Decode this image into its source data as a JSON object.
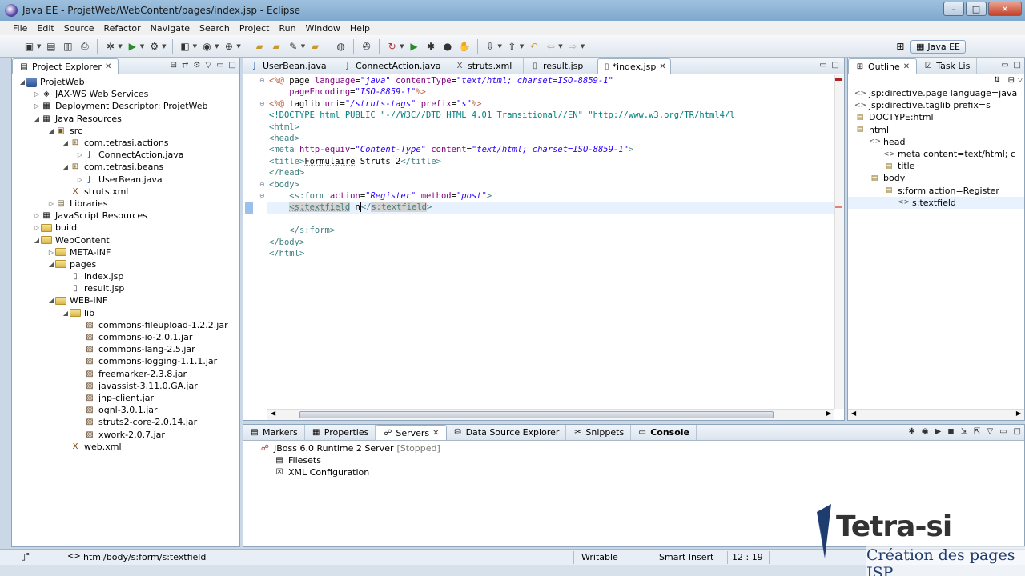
{
  "window": {
    "title": "Java EE - ProjetWeb/WebContent/pages/index.jsp - Eclipse"
  },
  "menu": [
    "File",
    "Edit",
    "Source",
    "Refactor",
    "Navigate",
    "Search",
    "Project",
    "Run",
    "Window",
    "Help"
  ],
  "perspective": {
    "label": "Java EE"
  },
  "explorer": {
    "tab_label": "Project Explorer",
    "items": [
      {
        "label": "ProjetWeb",
        "icon": "project-icon",
        "depth": 0,
        "twisty": "open"
      },
      {
        "label": "JAX-WS Web Services",
        "icon": "webservice-icon",
        "depth": 1,
        "twisty": "closed"
      },
      {
        "label": "Deployment Descriptor: ProjetWeb",
        "icon": "descriptor-icon",
        "depth": 1,
        "twisty": "closed"
      },
      {
        "label": "Java Resources",
        "icon": "java-resources-icon",
        "depth": 1,
        "twisty": "open"
      },
      {
        "label": "src",
        "icon": "source-folder-icon",
        "depth": 2,
        "twisty": "open"
      },
      {
        "label": "com.tetrasi.actions",
        "icon": "package-icon",
        "depth": 3,
        "twisty": "open"
      },
      {
        "label": "ConnectAction.java",
        "icon": "java-file-icon",
        "depth": 4,
        "twisty": "closed"
      },
      {
        "label": "com.tetrasi.beans",
        "icon": "package-icon",
        "depth": 3,
        "twisty": "open"
      },
      {
        "label": "UserBean.java",
        "icon": "java-file-icon",
        "depth": 4,
        "twisty": "closed"
      },
      {
        "label": "struts.xml",
        "icon": "xml-file-icon",
        "depth": 3,
        "twisty": "none"
      },
      {
        "label": "Libraries",
        "icon": "library-icon",
        "depth": 2,
        "twisty": "closed"
      },
      {
        "label": "JavaScript Resources",
        "icon": "javascript-icon",
        "depth": 1,
        "twisty": "closed"
      },
      {
        "label": "build",
        "icon": "folder-icon",
        "depth": 1,
        "twisty": "closed"
      },
      {
        "label": "WebContent",
        "icon": "folder-icon",
        "depth": 1,
        "twisty": "open"
      },
      {
        "label": "META-INF",
        "icon": "folder-icon",
        "depth": 2,
        "twisty": "closed"
      },
      {
        "label": "pages",
        "icon": "folder-open-icon",
        "depth": 2,
        "twisty": "open"
      },
      {
        "label": "index.jsp",
        "icon": "jsp-file-icon",
        "depth": 3,
        "twisty": "none"
      },
      {
        "label": "result.jsp",
        "icon": "jsp-file-icon",
        "depth": 3,
        "twisty": "none"
      },
      {
        "label": "WEB-INF",
        "icon": "folder-icon",
        "depth": 2,
        "twisty": "open"
      },
      {
        "label": "lib",
        "icon": "folder-open-icon",
        "depth": 3,
        "twisty": "open"
      },
      {
        "label": "commons-fileupload-1.2.2.jar",
        "icon": "jar-icon",
        "depth": 4,
        "twisty": "none"
      },
      {
        "label": "commons-io-2.0.1.jar",
        "icon": "jar-icon",
        "depth": 4,
        "twisty": "none"
      },
      {
        "label": "commons-lang-2.5.jar",
        "icon": "jar-icon",
        "depth": 4,
        "twisty": "none"
      },
      {
        "label": "commons-logging-1.1.1.jar",
        "icon": "jar-icon",
        "depth": 4,
        "twisty": "none"
      },
      {
        "label": "freemarker-2.3.8.jar",
        "icon": "jar-icon",
        "depth": 4,
        "twisty": "none"
      },
      {
        "label": "javassist-3.11.0.GA.jar",
        "icon": "jar-icon",
        "depth": 4,
        "twisty": "none"
      },
      {
        "label": "jnp-client.jar",
        "icon": "jar-icon",
        "depth": 4,
        "twisty": "none"
      },
      {
        "label": "ognl-3.0.1.jar",
        "icon": "jar-icon",
        "depth": 4,
        "twisty": "none"
      },
      {
        "label": "struts2-core-2.0.14.jar",
        "icon": "jar-icon",
        "depth": 4,
        "twisty": "none"
      },
      {
        "label": "xwork-2.0.7.jar",
        "icon": "jar-icon",
        "depth": 4,
        "twisty": "none"
      },
      {
        "label": "web.xml",
        "icon": "xml-file-icon",
        "depth": 3,
        "twisty": "none"
      }
    ]
  },
  "editor": {
    "tabs": [
      {
        "label": "UserBean.java",
        "active": false
      },
      {
        "label": "ConnectAction.java",
        "active": false
      },
      {
        "label": "struts.xml",
        "active": false
      },
      {
        "label": "result.jsp",
        "active": false
      },
      {
        "label": "*index.jsp",
        "active": true
      }
    ],
    "lines": [
      "<%@ page language=\"java\" contentType=\"text/html; charset=ISO-8859-1\"",
      "    pageEncoding=\"ISO-8859-1\"%>",
      "<%@ taglib uri=\"/struts-tags\" prefix=\"s\"%>",
      "<!DOCTYPE html PUBLIC \"-//W3C//DTD HTML 4.01 Transitional//EN\" \"http://www.w3.org/TR/html4/l",
      "<html>",
      "<head>",
      "<meta http-equiv=\"Content-Type\" content=\"text/html; charset=ISO-8859-1\">",
      "<title>Formulaire Struts 2</title>",
      "</head>",
      "<body>",
      "    <s:form action=\"Register\" method=\"post\">",
      "    <s:textfield n</s:textfield>",
      "",
      "    </s:form>",
      "</body>",
      "</html>"
    ]
  },
  "outline": {
    "tabs": [
      {
        "label": "Outline",
        "active": true
      },
      {
        "label": "Task Lis",
        "active": false
      }
    ],
    "items": [
      {
        "label": "jsp:directive.page language=java",
        "depth": 1,
        "icon": "tag-icon"
      },
      {
        "label": "jsp:directive.taglib prefix=s",
        "depth": 1,
        "icon": "tag-icon"
      },
      {
        "label": "DOCTYPE:html",
        "depth": 1,
        "icon": "doctype-icon"
      },
      {
        "label": "html",
        "depth": 1,
        "icon": "element-icon"
      },
      {
        "label": "head",
        "depth": 2,
        "icon": "tag-icon"
      },
      {
        "label": "meta content=text/html; c",
        "depth": 3,
        "icon": "tag-icon"
      },
      {
        "label": "title",
        "depth": 3,
        "icon": "element-icon"
      },
      {
        "label": "body",
        "depth": 2,
        "icon": "element-icon"
      },
      {
        "label": "s:form action=Register",
        "depth": 3,
        "icon": "element-icon"
      },
      {
        "label": "s:textfield",
        "depth": 4,
        "icon": "tag-icon"
      }
    ]
  },
  "bottom": {
    "tabs": [
      {
        "label": "Markers",
        "active": false
      },
      {
        "label": "Properties",
        "active": false
      },
      {
        "label": "Servers",
        "active": true
      },
      {
        "label": "Data Source Explorer",
        "active": false
      },
      {
        "label": "Snippets",
        "active": false
      },
      {
        "label": "Console",
        "active": false
      }
    ],
    "server": {
      "name": "JBoss 6.0 Runtime 2 Server",
      "state": "[Stopped]"
    },
    "children": [
      "Filesets",
      "XML Configuration"
    ]
  },
  "status": {
    "path": "html/body/s:form/s:textfield",
    "mode": "Writable",
    "insert": "Smart Insert",
    "position": "12 : 19"
  },
  "watermark": {
    "brand": "Tetra-si",
    "subtitle": "Création des pages JSP"
  }
}
